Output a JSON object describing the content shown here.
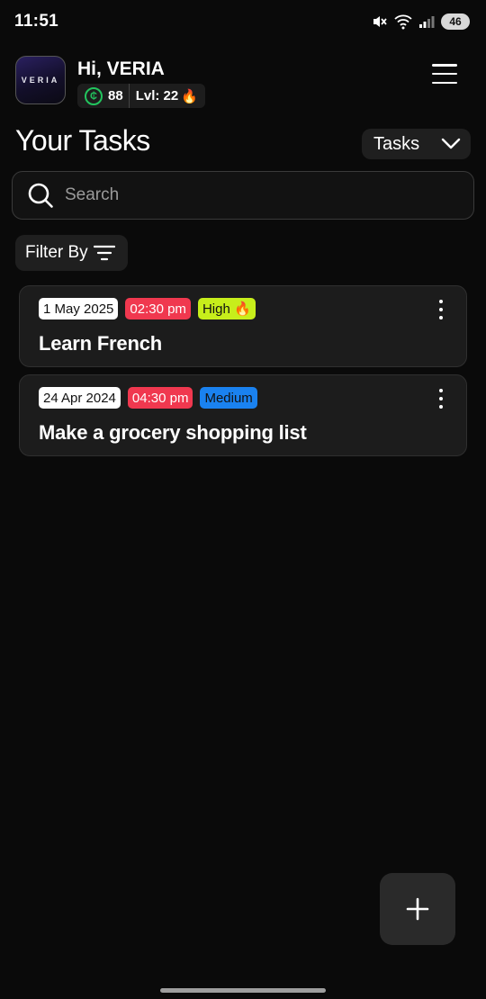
{
  "status_bar": {
    "time": "11:51",
    "battery": "46",
    "icons": [
      "mute-icon",
      "wifi-icon",
      "signal-icon"
    ]
  },
  "header": {
    "logo_text": "VERIA",
    "greeting": "Hi, VERIA",
    "coins": "88",
    "level": "Lvl: 22",
    "level_icon": "🔥",
    "menu_icon": "hamburger-menu-icon"
  },
  "page": {
    "title": "Your Tasks",
    "view_dropdown": "Tasks"
  },
  "search": {
    "placeholder": "Search"
  },
  "filter": {
    "label": "Filter By"
  },
  "tasks": [
    {
      "date": "1 May 2025",
      "time": "02:30 pm",
      "priority": "High 🔥",
      "priority_color": "#c7ee1b",
      "time_color": "#f0384f",
      "title": "Learn French"
    },
    {
      "date": "24 Apr 2024",
      "time": "04:30 pm",
      "priority": "Medium",
      "priority_color": "#1a82f0",
      "time_color": "#f0384f",
      "title": "Make a grocery shopping list"
    }
  ],
  "colors": {
    "background": "#0a0a0a",
    "card": "#1c1c1c",
    "coin_green": "#22c55e"
  }
}
